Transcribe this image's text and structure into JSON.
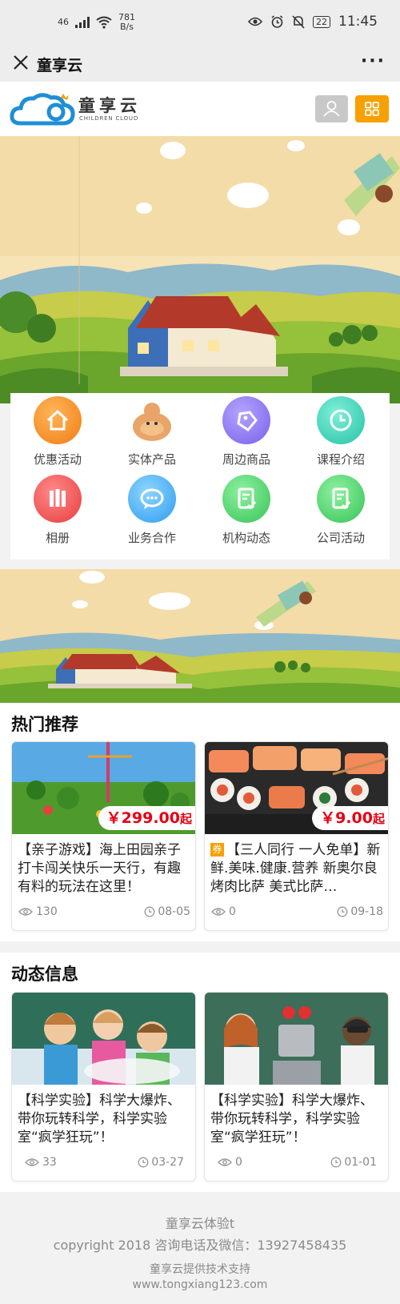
{
  "status_bar": {
    "network": "46",
    "speed": "781",
    "speed_unit": "B/s",
    "battery": "22",
    "time": "11:45"
  },
  "nav": {
    "title": "童享云",
    "more": "···"
  },
  "header": {
    "logo_text": "童享云",
    "logo_sub": "CHILDREN CLOUD"
  },
  "colors": {
    "accent": "#f7a000",
    "price": "#e60012"
  },
  "grid": [
    {
      "label": "优惠活动",
      "icon": "house-icon"
    },
    {
      "label": "实体产品",
      "icon": "duck-icon"
    },
    {
      "label": "周边商品",
      "icon": "tag-icon"
    },
    {
      "label": "课程介绍",
      "icon": "clock-icon"
    },
    {
      "label": "相册",
      "icon": "album-icon"
    },
    {
      "label": "业务合作",
      "icon": "chat-icon"
    },
    {
      "label": "机构动态",
      "icon": "document-check-icon"
    },
    {
      "label": "公司活动",
      "icon": "document-check-icon"
    }
  ],
  "hot": {
    "title": "热门推荐",
    "items": [
      {
        "price": "￥299.00",
        "price_suffix": "起",
        "text": "【亲子游戏】海上田园亲子打卡闯关快乐一天行，有趣有料的玩法在这里！",
        "views": "130",
        "date": "08-05"
      },
      {
        "price": "￥9.00",
        "price_suffix": "起",
        "coupon": "券",
        "text": "【三人同行 一人免单】新鲜.美味.健康.营养 新奥尔良烤肉比萨 美式比萨…",
        "views": "0",
        "date": "09-18"
      }
    ]
  },
  "news": {
    "title": "动态信息",
    "items": [
      {
        "text": "【科学实验】科学大爆炸、带你玩转科学，科学实验室“疯学狂玩”！",
        "views": "33",
        "date": "03-27"
      },
      {
        "text": "【科学实验】科学大爆炸、带你玩转科学，科学实验室“疯学狂玩”！",
        "views": "0",
        "date": "01-01"
      }
    ]
  },
  "footer": {
    "line1": "童享云体验t",
    "line2": "copyright 2018 咨询电话及微信：13927458435",
    "line3": "童享云提供技术支持",
    "line4": "www.tongxiang123.com"
  }
}
